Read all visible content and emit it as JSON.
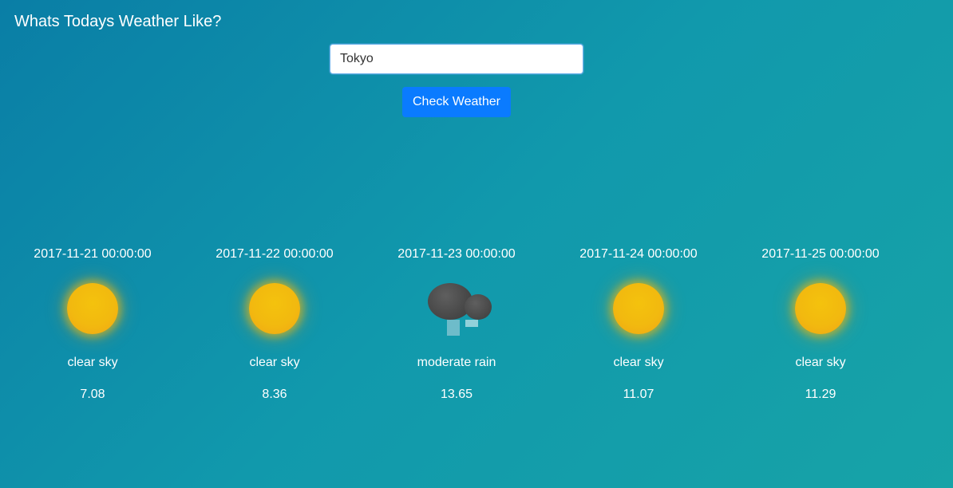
{
  "header": {
    "title": "Whats Todays Weather Like?"
  },
  "search": {
    "value": "Tokyo",
    "button_label": "Check Weather"
  },
  "forecast": [
    {
      "date": "2017-11-21 00:00:00",
      "description": "clear sky",
      "temp": "7.08",
      "icon": "sun-icon"
    },
    {
      "date": "2017-11-22 00:00:00",
      "description": "clear sky",
      "temp": "8.36",
      "icon": "sun-icon"
    },
    {
      "date": "2017-11-23 00:00:00",
      "description": "moderate rain",
      "temp": "13.65",
      "icon": "rain-cloud-icon"
    },
    {
      "date": "2017-11-24 00:00:00",
      "description": "clear sky",
      "temp": "11.07",
      "icon": "sun-icon"
    },
    {
      "date": "2017-11-25 00:00:00",
      "description": "clear sky",
      "temp": "11.29",
      "icon": "sun-icon"
    }
  ],
  "colors": {
    "background_start": "#0a7ea6",
    "background_end": "#17a3a7",
    "button": "#0a7bff",
    "sun": "#f2b90f",
    "cloud": "#444444"
  }
}
